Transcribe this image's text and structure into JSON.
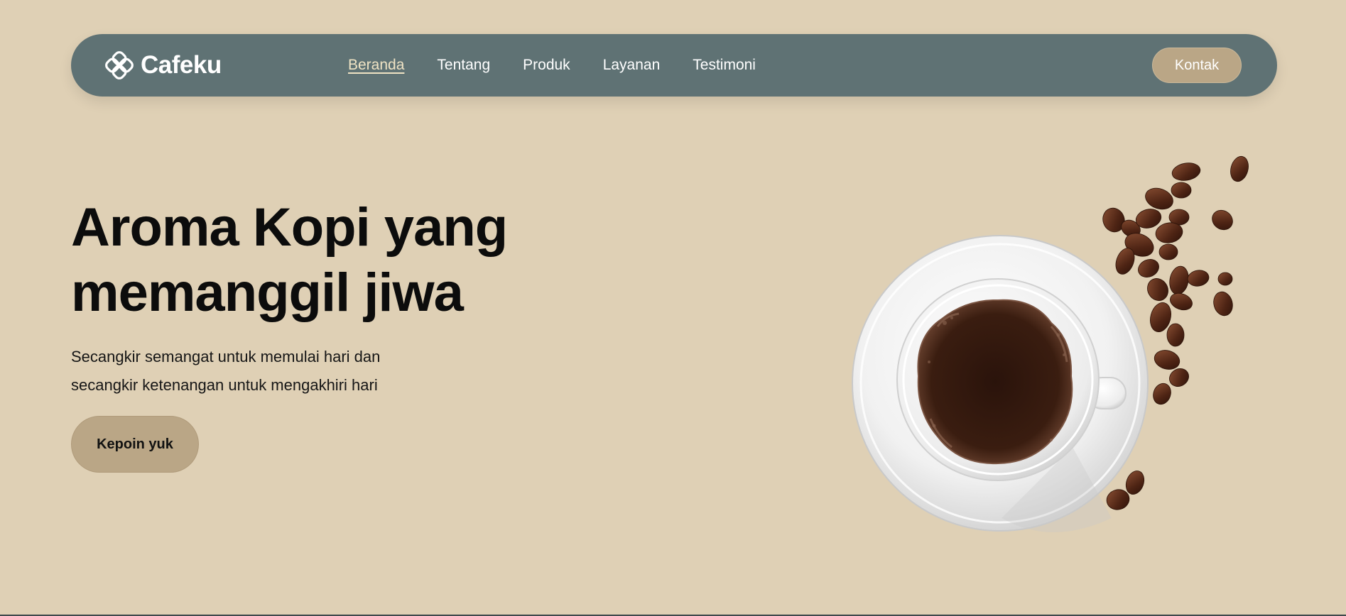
{
  "brand": {
    "name": "Cafeku",
    "logo_icon": "flower-knot-icon"
  },
  "nav": {
    "links": [
      {
        "label": "Beranda",
        "active": true
      },
      {
        "label": "Tentang",
        "active": false
      },
      {
        "label": "Produk",
        "active": false
      },
      {
        "label": "Layanan",
        "active": false
      },
      {
        "label": "Testimoni",
        "active": false
      }
    ],
    "contact_label": "Kontak"
  },
  "hero": {
    "title_lines": [
      "Aroma Kopi yang",
      "memanggil jiwa"
    ],
    "subtitle_lines": [
      "Secangkir semangat untuk memulai hari dan",
      "secangkir ketenangan untuk mengakhiri hari"
    ],
    "cta_label": "Kepoin yuk",
    "image": "coffee-cup-with-beans-illustration"
  },
  "colors": {
    "background": "#dfd0b5",
    "navbar": "#5f7274",
    "accent": "#baa686",
    "active_link": "#efe3c4",
    "text": "#0c0c0c"
  }
}
